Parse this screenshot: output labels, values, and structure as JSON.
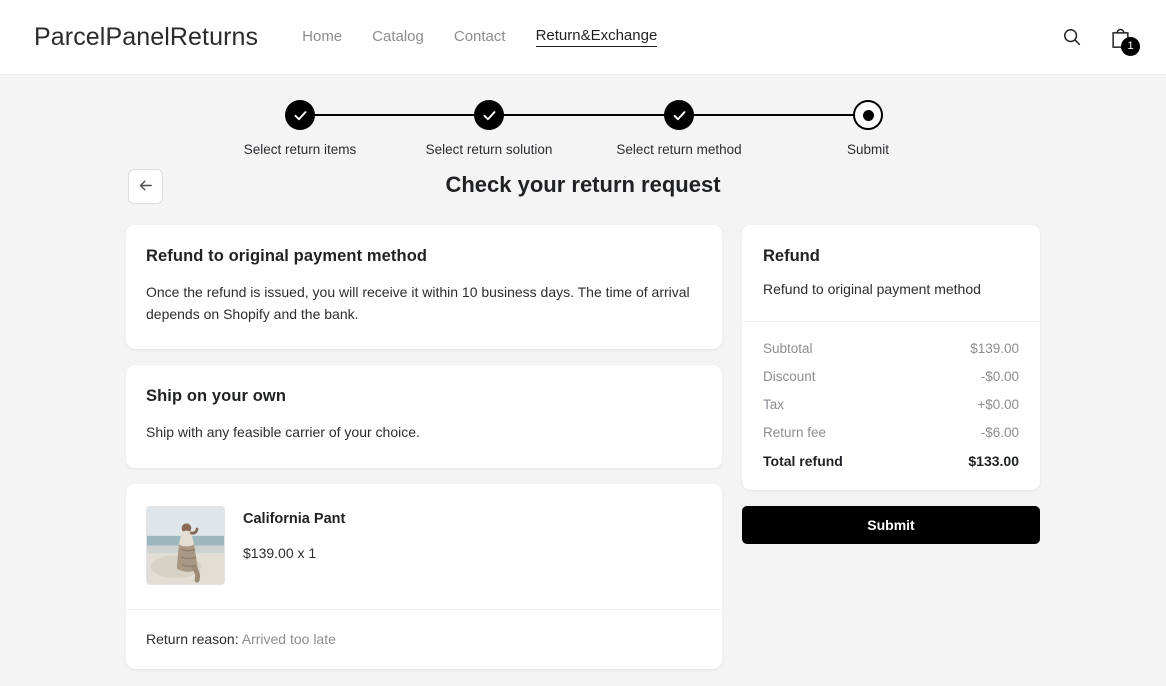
{
  "header": {
    "brand": "ParcelPanelReturns",
    "nav": [
      {
        "label": "Home",
        "active": false
      },
      {
        "label": "Catalog",
        "active": false
      },
      {
        "label": "Contact",
        "active": false
      },
      {
        "label": "Return&Exchange",
        "active": true
      }
    ],
    "search_icon": "search-icon",
    "cart_icon": "shopping-bag-icon",
    "cart_count": "1"
  },
  "stepper": {
    "back_icon": "arrow-left-icon",
    "steps": [
      {
        "label": "Select return items",
        "state": "complete"
      },
      {
        "label": "Select return solution",
        "state": "complete"
      },
      {
        "label": "Select return method",
        "state": "complete"
      },
      {
        "label": "Submit",
        "state": "current"
      }
    ]
  },
  "page_title": "Check your return request",
  "refund_method_card": {
    "title": "Refund to original payment method",
    "body": "Once the refund is issued, you will receive it within 10 business days. The time of arrival depends on Shopify and the bank."
  },
  "shipping_card": {
    "title": "Ship on your own",
    "body": "Ship with any feasible carrier of your choice."
  },
  "product_card": {
    "image_alt": "woman-sitting-on-beach-photo",
    "name": "California Pant",
    "price_line": "$139.00 x 1",
    "return_reason_label": "Return reason:",
    "return_reason_value": "Arrived too late"
  },
  "refund_panel": {
    "title": "Refund",
    "subtitle": "Refund to original payment method",
    "lines": [
      {
        "label": "Subtotal",
        "value": "$139.00"
      },
      {
        "label": "Discount",
        "value": "-$0.00"
      },
      {
        "label": "Tax",
        "value": "+$0.00"
      },
      {
        "label": "Return fee",
        "value": "-$6.00"
      }
    ],
    "total": {
      "label": "Total refund",
      "value": "$133.00"
    }
  },
  "submit_button": "Submit",
  "colors": {
    "page_bg": "#f4f4f4",
    "card_bg": "#ffffff",
    "accent": "#000000",
    "muted_text": "#8b8d92"
  }
}
